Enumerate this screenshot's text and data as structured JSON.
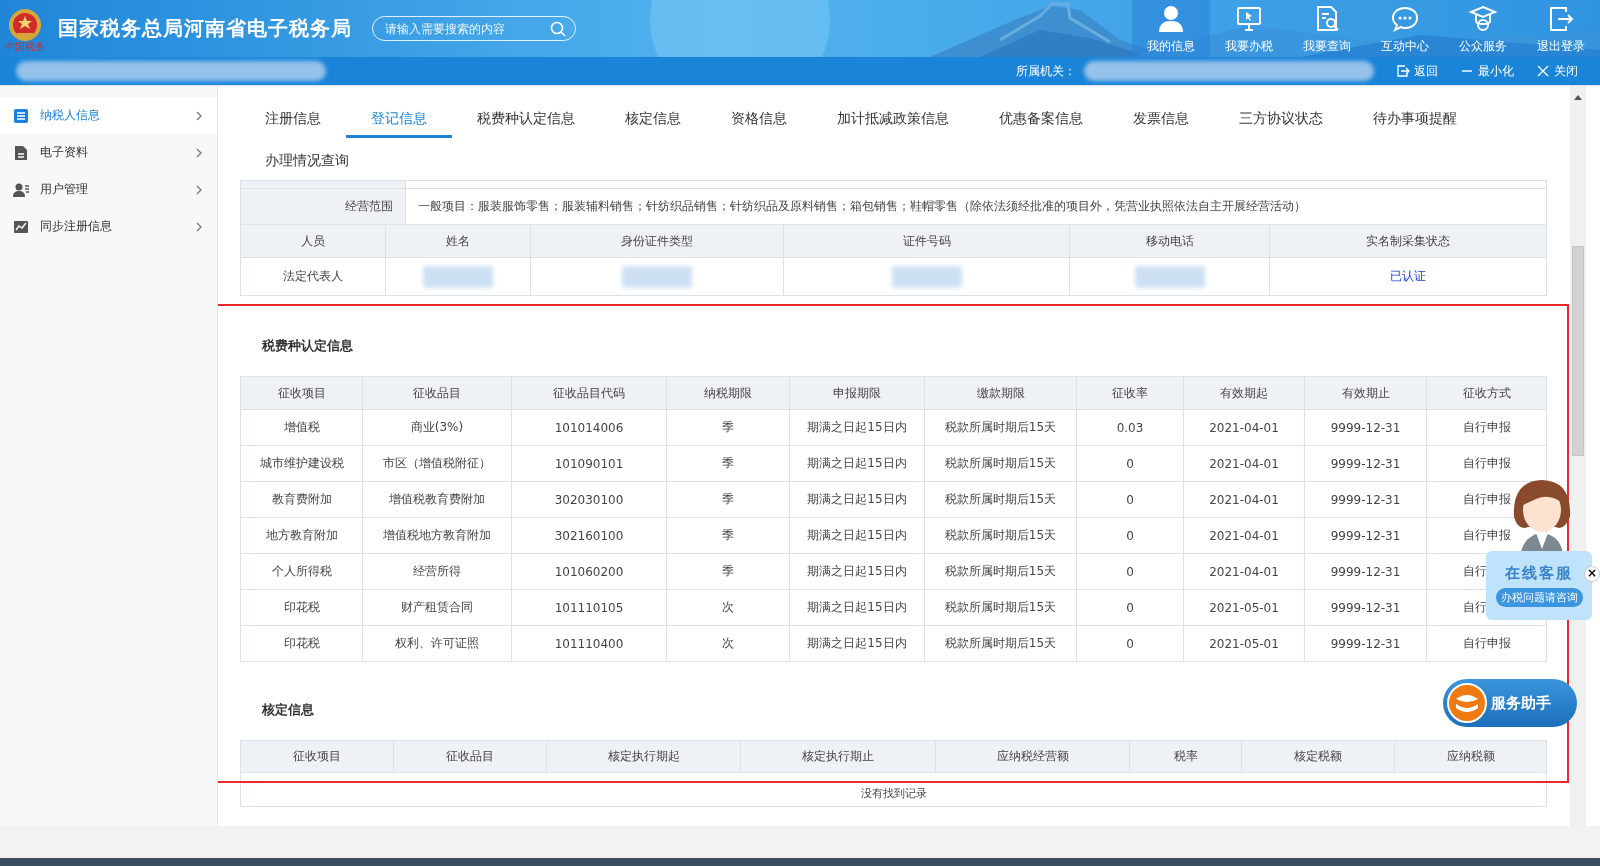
{
  "header": {
    "logo_caption": "中国税务",
    "title": "国家税务总局河南省电子税务局",
    "search": {
      "placeholder": "请输入需要搜索的内容"
    },
    "nav": [
      {
        "label": "我的信息",
        "selected": true
      },
      {
        "label": "我要办税",
        "selected": false
      },
      {
        "label": "我要查询",
        "selected": false
      },
      {
        "label": "互动中心",
        "selected": false
      },
      {
        "label": "公众服务",
        "selected": false
      },
      {
        "label": "退出登录",
        "selected": false
      }
    ]
  },
  "subbar": {
    "office_label": "所属机关：",
    "actions": [
      {
        "label": "返回"
      },
      {
        "label": "最小化"
      },
      {
        "label": "关闭"
      }
    ]
  },
  "sidebar": {
    "items": [
      {
        "label": "纳税人信息",
        "selected": true
      },
      {
        "label": "电子资料",
        "selected": false
      },
      {
        "label": "用户管理",
        "selected": false
      },
      {
        "label": "同步注册信息",
        "selected": false
      }
    ]
  },
  "tabs": [
    {
      "label": "注册信息",
      "selected": false
    },
    {
      "label": "登记信息",
      "selected": true
    },
    {
      "label": "税费种认定信息",
      "selected": false
    },
    {
      "label": "核定信息",
      "selected": false
    },
    {
      "label": "资格信息",
      "selected": false
    },
    {
      "label": "加计抵减政策信息",
      "selected": false
    },
    {
      "label": "优惠备案信息",
      "selected": false
    },
    {
      "label": "发票信息",
      "selected": false
    },
    {
      "label": "三方协议状态",
      "selected": false
    },
    {
      "label": "待办事项提醒",
      "selected": false
    },
    {
      "label": "办理情况查询",
      "selected": false
    }
  ],
  "registration": {
    "scope_label": "经营范围",
    "scope_value": "一般项目：服装服饰零售；服装辅料销售；针纺织品销售；针纺织品及原料销售；箱包销售；鞋帽零售（除依法须经批准的项目外，凭营业执照依法自主开展经营活动）",
    "people_columns": [
      "人员",
      "姓名",
      "身份证件类型",
      "证件号码",
      "移动电话",
      "实名制采集状态"
    ],
    "people_rows": [
      {
        "role": "法定代表人",
        "status": "已认证"
      }
    ]
  },
  "tax_types": {
    "title": "税费种认定信息",
    "columns": [
      "征收项目",
      "征收品目",
      "征收品目代码",
      "纳税期限",
      "申报期限",
      "缴款期限",
      "征收率",
      "有效期起",
      "有效期止",
      "征收方式"
    ],
    "rows": [
      [
        "增值税",
        "商业(3%)",
        "101014006",
        "季",
        "期满之日起15日内",
        "税款所属时期后15天",
        "0.03",
        "2021-04-01",
        "9999-12-31",
        "自行申报"
      ],
      [
        "城市维护建设税",
        "市区（增值税附征）",
        "101090101",
        "季",
        "期满之日起15日内",
        "税款所属时期后15天",
        "0",
        "2021-04-01",
        "9999-12-31",
        "自行申报"
      ],
      [
        "教育费附加",
        "增值税教育费附加",
        "302030100",
        "季",
        "期满之日起15日内",
        "税款所属时期后15天",
        "0",
        "2021-04-01",
        "9999-12-31",
        "自行申报"
      ],
      [
        "地方教育附加",
        "增值税地方教育附加",
        "302160100",
        "季",
        "期满之日起15日内",
        "税款所属时期后15天",
        "0",
        "2021-04-01",
        "9999-12-31",
        "自行申报"
      ],
      [
        "个人所得税",
        "经营所得",
        "101060200",
        "季",
        "期满之日起15日内",
        "税款所属时期后15天",
        "0",
        "2021-04-01",
        "9999-12-31",
        "自行"
      ],
      [
        "印花税",
        "财产租赁合同",
        "101110105",
        "次",
        "期满之日起15日内",
        "税款所属时期后15天",
        "0",
        "2021-05-01",
        "9999-12-31",
        "自行"
      ],
      [
        "印花税",
        "权利、许可证照",
        "101110400",
        "次",
        "期满之日起15日内",
        "税款所属时期后15天",
        "0",
        "2021-05-01",
        "9999-12-31",
        "自行申报"
      ]
    ]
  },
  "assessment": {
    "title": "核定信息",
    "columns": [
      "征收项目",
      "征收品目",
      "核定执行期起",
      "核定执行期止",
      "应纳税经营额",
      "税率",
      "核定税额",
      "应纳税额"
    ],
    "empty_text": "没有找到记录"
  },
  "chat_widget": {
    "title": "在线客服",
    "subtitle": "办税问题请咨询",
    "close": "×"
  },
  "assistant_button": {
    "label": "服务助手"
  }
}
